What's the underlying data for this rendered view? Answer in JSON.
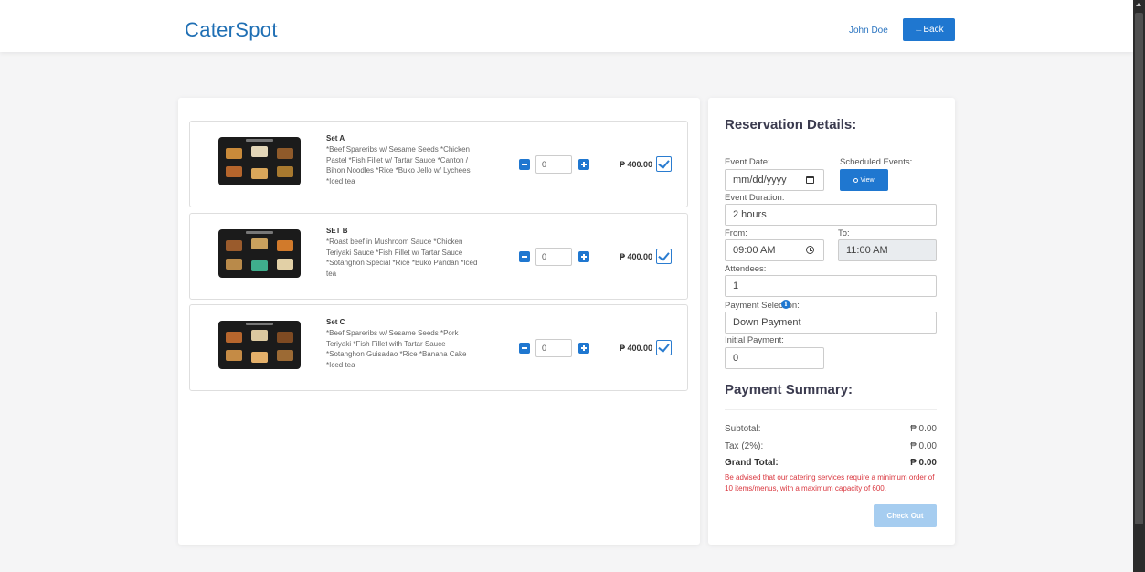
{
  "header": {
    "brand": "CaterSpot",
    "user_name": "John Doe",
    "back_label": "←Back"
  },
  "menu_sets": [
    {
      "title": "Set A",
      "description": "*Beef Spareribs w/ Sesame Seeds *Chicken Pastel *Fish Fillet w/ Tartar Sauce *Canton / Bihon Noodles *Rice *Buko Jello w/ Lychees *Iced tea",
      "quantity": "0",
      "price": "₱ 400.00",
      "selected": true
    },
    {
      "title": "SET B",
      "description": "*Roast beef in Mushroom Sauce *Chicken Teriyaki Sauce *Fish Fillet w/ Tartar Sauce *Sotanghon Special *Rice *Buko Pandan *Iced tea",
      "quantity": "0",
      "price": "₱ 400.00",
      "selected": true
    },
    {
      "title": "Set C",
      "description": "*Beef Spareribs w/ Sesame Seeds *Pork Teriyaki *Fish Fillet with Tartar Sauce *Sotanghon Guisadao *Rice *Banana Cake *Iced tea",
      "quantity": "0",
      "price": "₱ 400.00",
      "selected": true
    }
  ],
  "reservation": {
    "title": "Reservation Details:",
    "event_date_label": "Event Date:",
    "event_date_placeholder": "mm/dd/yyyy",
    "scheduled_label": "Scheduled Events:",
    "view_label": "View",
    "duration_label": "Event Duration:",
    "duration_value": "2 hours",
    "from_label": "From:",
    "from_value": "09:00 AM",
    "to_label": "To:",
    "to_value": "11:00 AM",
    "attendees_label": "Attendees:",
    "attendees_value": "1",
    "payment_selection_label": "Payment Selection:",
    "payment_selection_value": "Down Payment",
    "initial_payment_label": "Initial Payment:",
    "initial_payment_value": "0"
  },
  "summary": {
    "title": "Payment Summary:",
    "subtotal_label": "Subtotal:",
    "subtotal_value": "₱ 0.00",
    "tax_label": "Tax (2%):",
    "tax_value": "₱ 0.00",
    "grand_total_label": "Grand Total:",
    "grand_total_value": "₱ 0.00",
    "notice": "Be advised that our catering services require a minimum order of 10 items/menus, with a maximum capacity of 600.",
    "checkout_label": "Check Out"
  },
  "colors": {
    "accent": "#1f77d0",
    "brand": "#1f6fb4",
    "warning": "#d9363e",
    "checkout_disabled": "#a6cdf0"
  }
}
